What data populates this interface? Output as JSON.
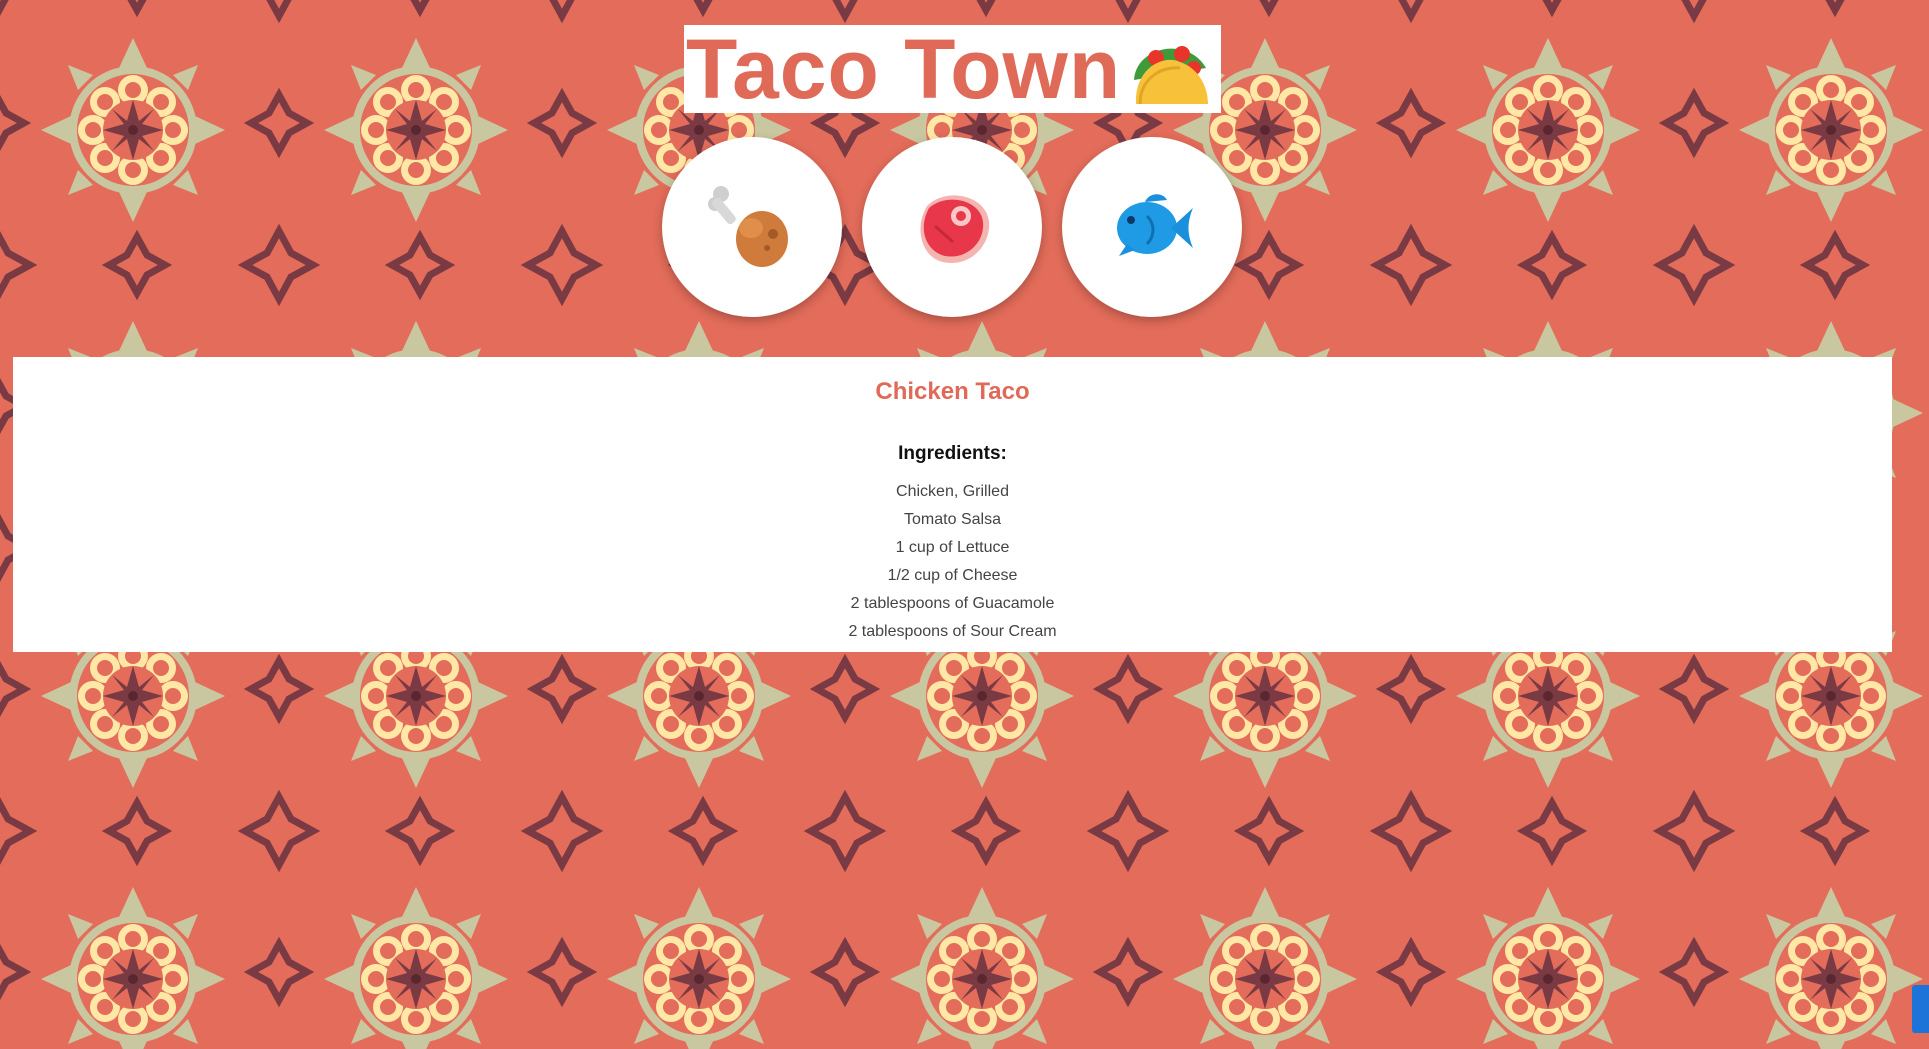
{
  "header": {
    "title": "Taco Town",
    "title_icon": "taco-icon"
  },
  "meat_options": [
    {
      "icon": "chicken-leg-icon"
    },
    {
      "icon": "steak-icon"
    },
    {
      "icon": "fish-icon"
    }
  ],
  "recipe": {
    "title": "Chicken Taco",
    "ingredients_heading": "Ingredients:",
    "ingredients": [
      "Chicken, Grilled",
      "Tomato Salsa",
      "1 cup of Lettuce",
      "1/2 cup of Cheese",
      "2 tablespoons of Guacamole",
      "2 tablespoons of Sour Cream"
    ]
  },
  "colors": {
    "background": "#e36c5a",
    "accent": "#e06a58",
    "pattern_dark": "#7a3a44",
    "pattern_cream": "#ffe7a6",
    "pattern_sage": "#c9c7a0",
    "scrollbar_thumb": "#1c74d8"
  }
}
